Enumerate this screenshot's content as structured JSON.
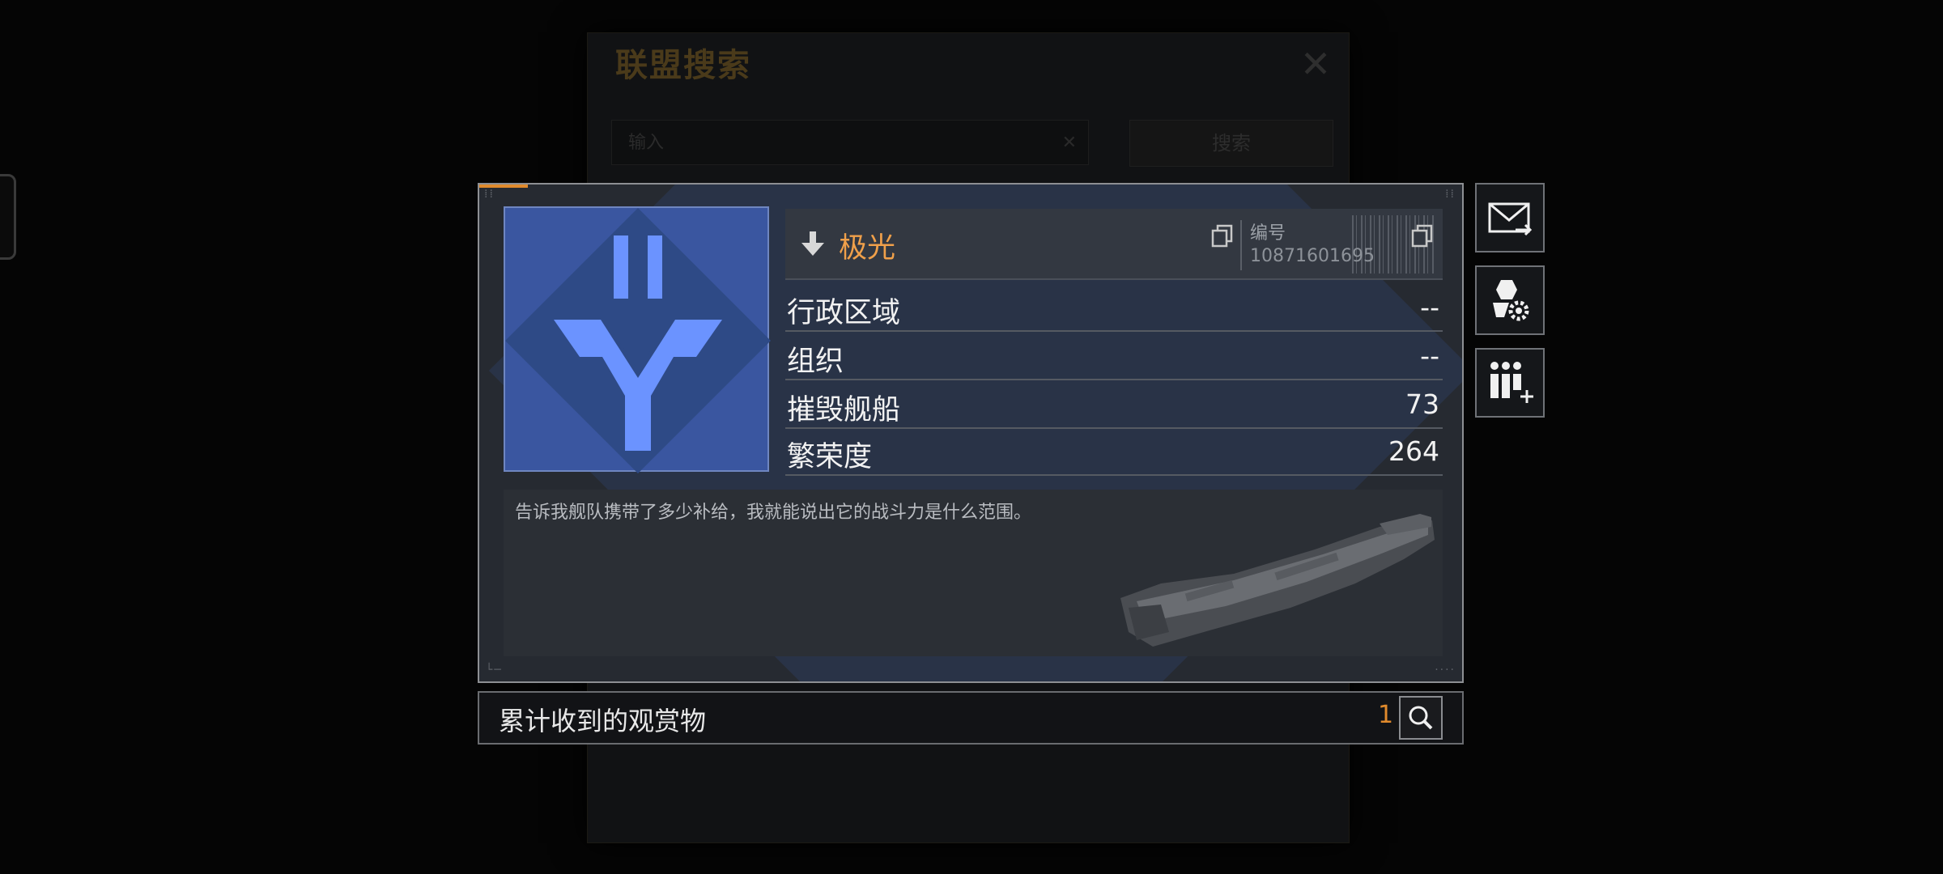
{
  "background_dialog": {
    "title": "联盟搜索",
    "input_placeholder": "输入",
    "search_label": "搜索"
  },
  "profile": {
    "name": "极光",
    "id_label": "编号",
    "id_value": "10871601695",
    "stats": [
      {
        "label": "行政区域",
        "value": "--"
      },
      {
        "label": "组织",
        "value": "--"
      },
      {
        "label": "摧毁舰船",
        "value": "73"
      },
      {
        "label": "繁荣度",
        "value": "264"
      }
    ],
    "description": "告诉我舰队携带了多少补给，我就能说出它的战斗力是什么范围。"
  },
  "viewing": {
    "label": "累计收到的观赏物",
    "count": "1"
  },
  "icons": {
    "emblem": "alliance-emblem",
    "download": "download-arrow-icon",
    "copy": "copy-icon",
    "mail": "mail-forward-icon",
    "settings": "member-settings-icon",
    "add_friend": "add-member-icon",
    "search": "search-icon"
  },
  "colors": {
    "accent": "#e08a2c",
    "emblem_bg": "#3a56a0",
    "emblem_fg": "#6b93ff"
  }
}
